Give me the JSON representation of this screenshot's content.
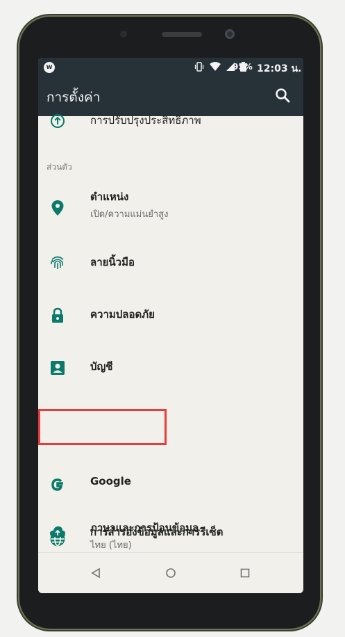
{
  "status_bar": {
    "logo": "w",
    "icons": [
      "vibrate-icon",
      "wifi-icon",
      "signal-icon",
      "battery-icon"
    ],
    "battery": "95%",
    "time": "12:03 น."
  },
  "app_bar": {
    "title": "การตั้งค่า",
    "search_icon": "search-icon"
  },
  "top_item": {
    "title": "การปรับปรุงประสิทธิภาพ",
    "icon": "arrow-up-icon"
  },
  "section": {
    "label": "ส่วนตัว"
  },
  "items": [
    {
      "title": "ตำแหน่ง",
      "subtitle": "เปิด/ความแม่นยำสูง",
      "icon": "location-pin-icon"
    },
    {
      "title": "ลายนิ้วมือ",
      "icon": "fingerprint-icon"
    },
    {
      "title": "ความปลอดภัย",
      "icon": "lock-icon"
    },
    {
      "title": "บัญชี",
      "icon": "account-icon"
    },
    {
      "title": "Google",
      "icon": "google-icon"
    },
    {
      "title": "ภาษาและการป้อนข้อมูล",
      "subtitle": "ไทย (ไทย)",
      "icon": "globe-icon"
    },
    {
      "title": "การสำรองข้อมูลและการรีเซ็ต",
      "icon": "cloud-upload-icon"
    }
  ],
  "colors": {
    "appbar": "#273138",
    "accent": "#0c7a6b",
    "highlight": "#ec3b3b",
    "screen_bg": "#f1f0ea"
  },
  "nav": {
    "back": "back-icon",
    "home": "home-icon",
    "recents": "recents-icon"
  }
}
